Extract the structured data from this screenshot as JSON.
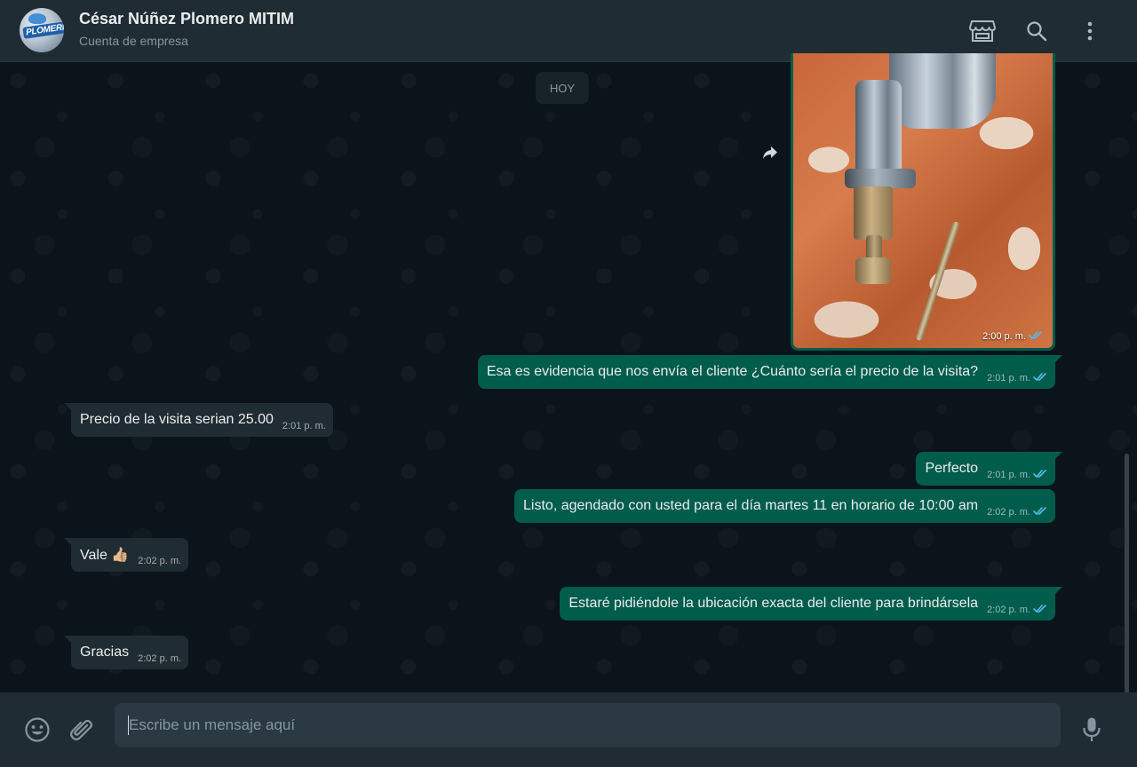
{
  "header": {
    "contact_name": "César Núñez Plomero MITIM",
    "contact_subtitle": "Cuenta de empresa",
    "avatar_logo_text": "PLOMERIA",
    "icons": [
      "catalog-store-icon",
      "search-icon",
      "menu-kebab-icon"
    ]
  },
  "chat": {
    "day_label": "HOY",
    "image_message": {
      "time": "2:00 p. m.",
      "status": "read"
    },
    "messages": [
      {
        "direction": "out",
        "text": "Esa es evidencia que nos envía el cliente ¿Cuánto sería el precio de la visita?",
        "time": "2:01 p. m.",
        "status": "read"
      },
      {
        "direction": "in",
        "text": "Precio de la visita serian 25.00",
        "time": "2:01 p. m."
      },
      {
        "direction": "out",
        "text": "Perfecto",
        "time": "2:01 p. m.",
        "status": "read"
      },
      {
        "direction": "out",
        "text": "Listo, agendado con usted para el día martes 11 en horario de 10:00 am",
        "time": "2:02 p. m.",
        "status": "read"
      },
      {
        "direction": "in",
        "text": "Vale 👍🏼",
        "time": "2:02 p. m."
      },
      {
        "direction": "out",
        "text": "Estaré pidiéndole la ubicación exacta del cliente para brindársela",
        "time": "2:02 p. m.",
        "status": "read"
      },
      {
        "direction": "in",
        "text": "Gracias",
        "time": "2:02 p. m."
      }
    ]
  },
  "composer": {
    "placeholder": "Escribe un mensaje aquí",
    "icons": [
      "emoji-icon",
      "attach-clip-icon",
      "microphone-icon"
    ]
  },
  "colors": {
    "outgoing_bubble": "#005c4b",
    "incoming_bubble": "#202c33",
    "header_bg": "#202c33",
    "chat_bg": "#0b141a",
    "read_ticks": "#53bdeb"
  }
}
